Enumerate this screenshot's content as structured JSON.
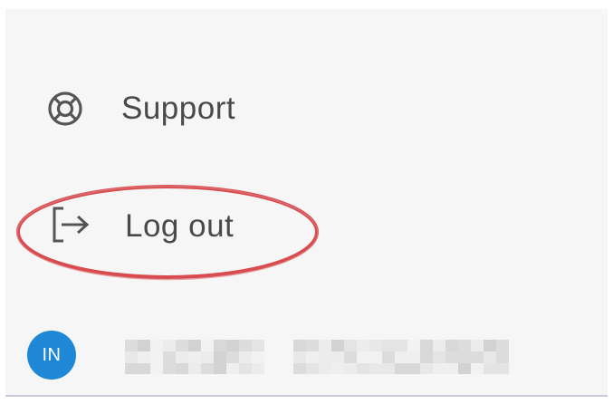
{
  "menu": {
    "items": [
      {
        "label": "Support",
        "icon": "lifebuoy-icon"
      },
      {
        "label": "Log out",
        "icon": "logout-icon"
      }
    ]
  },
  "annotation": {
    "shape": "ellipse",
    "color": "#d84b4f",
    "target": "Log out"
  },
  "user": {
    "initials": "IN",
    "avatar_color": "#1e88d6",
    "name_redacted": true
  }
}
